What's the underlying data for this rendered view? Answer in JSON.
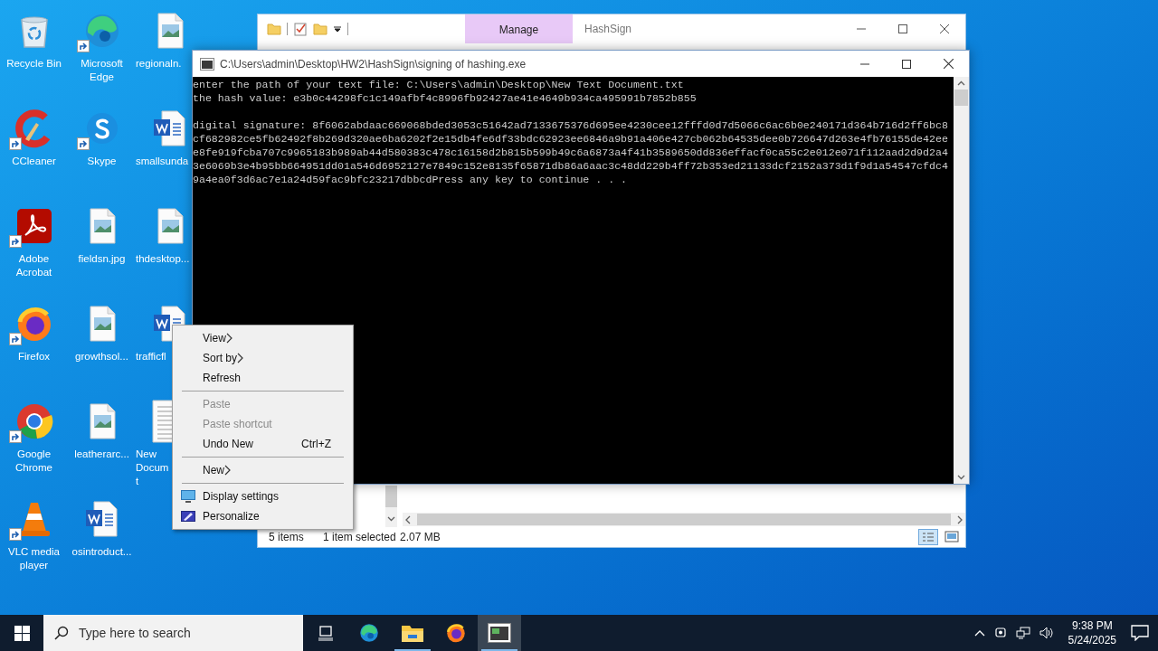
{
  "desktop_icons": [
    {
      "label": "Recycle Bin",
      "kind": "recycle",
      "shortcut": false,
      "cut": false
    },
    {
      "label": "CCleaner",
      "kind": "ccleaner",
      "shortcut": true,
      "cut": false
    },
    {
      "label": "Adobe Acrobat",
      "kind": "acrobat",
      "shortcut": true,
      "cut": false
    },
    {
      "label": "Firefox",
      "kind": "firefox",
      "shortcut": true,
      "cut": false
    },
    {
      "label": "Google Chrome",
      "kind": "chrome",
      "shortcut": true,
      "cut": false
    },
    {
      "label": "VLC media player",
      "kind": "vlc",
      "shortcut": true,
      "cut": false
    },
    {
      "label": "Microsoft Edge",
      "kind": "edge",
      "shortcut": true,
      "cut": false
    },
    {
      "label": "Skype",
      "kind": "skype",
      "shortcut": true,
      "cut": false
    },
    {
      "label": "fieldsn.jpg",
      "kind": "image",
      "shortcut": false,
      "cut": false
    },
    {
      "label": "growthsol...",
      "kind": "image",
      "shortcut": false,
      "cut": false
    },
    {
      "label": "leatherarc...",
      "kind": "image",
      "shortcut": false,
      "cut": false
    },
    {
      "label": "osintroduct...",
      "kind": "word",
      "shortcut": false,
      "cut": false
    },
    {
      "label": "regionaln.",
      "kind": "image",
      "shortcut": false,
      "cut": true
    },
    {
      "label": "smallsunda",
      "kind": "word",
      "shortcut": false,
      "cut": true
    },
    {
      "label": "thdesktop...",
      "kind": "image",
      "shortcut": false,
      "cut": true
    },
    {
      "label": "trafficfl",
      "kind": "word",
      "shortcut": false,
      "cut": true
    },
    {
      "label": "New\nDocum\nt",
      "kind": "text",
      "shortcut": false,
      "cut": true
    }
  ],
  "explorer_window": {
    "title": "HashSign",
    "ribbon_context_tab": "Manage",
    "status_bar": {
      "item_count": "5 items",
      "selection": "1 item selected",
      "size": "2.07 MB"
    }
  },
  "console_window": {
    "title": "C:\\Users\\admin\\Desktop\\HW2\\HashSign\\signing of hashing.exe",
    "output": [
      [
        "enter the path of your text file: C:\\Users\\admin\\Desktop\\New Text Document.txt",
        "the hash value: e3b0c44298fc1c149afbf4c8996fb92427ae41e4649b934ca495991b7852b855"
      ],
      [
        "digital signature: 8f6062abdaac669068bded3053c51642ad7133675376d695ee4230cee12fffd0d7d5066c6ac6b0e240171d364b716d2ff6bc8",
        "cf682982ce5fb62492f8b269d320ae6ba6202f2e15db4fe6df33bdc62923ee6846a9b91a406e427cb062b64535dee0b726647d263e4fb76155de42ee",
        "e8fe919fcba707c9965183b989ab44d580383c478c16158d2b815b599b49c6a6873a4f41b3589650dd836effacf0ca55c2e012e071f112aad2d9d2a4",
        "3e6069b3e4b95bb664951dd01a546d6952127e7849c152e8135f65871db86a6aac3c48dd229b4ff72b353ed21133dcf2152a373d1f9d1a54547cfdc4",
        "9a4ea0f3d6ac7e1a24d59fac9bfc23217dbbcdPress any key to continue . . ."
      ]
    ]
  },
  "context_menu": {
    "groups": [
      [
        {
          "kind": "plain",
          "label": "View",
          "submenu": true,
          "disabled": false
        },
        {
          "kind": "plain",
          "label": "Sort by",
          "submenu": true,
          "disabled": false
        },
        {
          "kind": "plain",
          "label": "Refresh",
          "submenu": false,
          "disabled": false
        }
      ],
      [
        {
          "kind": "plain",
          "label": "Paste",
          "submenu": false,
          "disabled": true
        },
        {
          "kind": "plain",
          "label": "Paste shortcut",
          "submenu": false,
          "disabled": true
        },
        {
          "kind": "plain",
          "label": "Undo New",
          "shortcut": "Ctrl+Z",
          "submenu": false,
          "disabled": false
        }
      ],
      [
        {
          "kind": "plain",
          "label": "New",
          "submenu": true,
          "disabled": false
        }
      ],
      [
        {
          "kind": "display",
          "label": "Display settings",
          "submenu": false,
          "disabled": false
        },
        {
          "kind": "personalize",
          "label": "Personalize",
          "submenu": false,
          "disabled": false
        }
      ]
    ]
  },
  "taskbar": {
    "search_placeholder": "Type here to search",
    "apps": [
      {
        "kind": "taskview",
        "running": false,
        "active": false
      },
      {
        "kind": "edge",
        "running": false,
        "active": false
      },
      {
        "kind": "explorer",
        "running": true,
        "active": false
      },
      {
        "kind": "firefox",
        "running": false,
        "active": false
      },
      {
        "kind": "console",
        "running": true,
        "active": true
      }
    ],
    "clock": {
      "time": "9:38 PM",
      "date": "5/24/2025"
    }
  }
}
